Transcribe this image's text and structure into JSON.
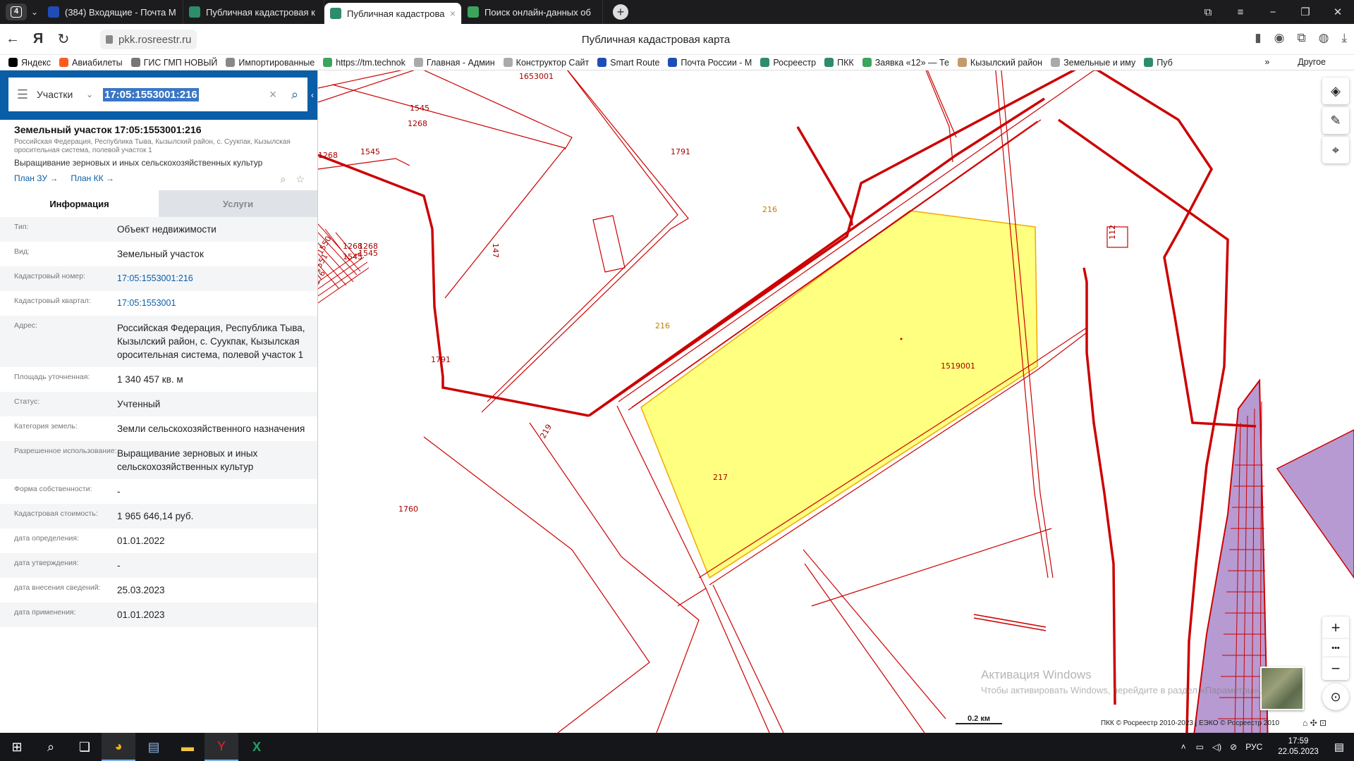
{
  "browser": {
    "tab_count": "4",
    "tabs": [
      {
        "title": "(384) Входящие - Почта M",
        "favcolor": "#1e4db7",
        "active": false
      },
      {
        "title": "Публичная кадастровая к",
        "favcolor": "#2d8c6a",
        "active": false
      },
      {
        "title": "Публичная кадастрова",
        "favcolor": "#2d8c6a",
        "active": true
      },
      {
        "title": "Поиск онлайн-данных об",
        "favcolor": "#3ba55c",
        "active": false
      }
    ],
    "url": "pkk.rosreestr.ru",
    "page_title": "Публичная кадастровая карта",
    "bookmarks": [
      {
        "label": "Яндекс",
        "color": "#000000"
      },
      {
        "label": "Авиабилеты",
        "color": "#ff5a1f"
      },
      {
        "label": "ГИС ГМП НОВЫЙ",
        "color": "#777777"
      },
      {
        "label": "Импортированные",
        "color": "#888888"
      },
      {
        "label": "https://tm.technok",
        "color": "#3ba55c"
      },
      {
        "label": "Главная - Админ",
        "color": "#aaaaaa"
      },
      {
        "label": "Конструктор Сайт",
        "color": "#aaaaaa"
      },
      {
        "label": "Smart Route",
        "color": "#1e4db7"
      },
      {
        "label": "Почта России - М",
        "color": "#1e4db7"
      },
      {
        "label": "Росреестр",
        "color": "#2d8c6a"
      },
      {
        "label": "ПКК",
        "color": "#2d8c6a"
      },
      {
        "label": "Заявка «12» — Те",
        "color": "#3ba55c"
      },
      {
        "label": "Кызылский район",
        "color": "#c59a6b"
      },
      {
        "label": "Земельные и иму",
        "color": "#aaaaaa"
      },
      {
        "label": "Пуб",
        "color": "#2d8c6a"
      }
    ],
    "bookmarks_more": "»",
    "other_label": "Другое"
  },
  "search": {
    "type_label": "Участки",
    "query": "17:05:1553001:216"
  },
  "object": {
    "title": "Земельный участок 17:05:1553001:216",
    "address_short": "Российская Федерация, Республика Тыва, Кызылский район, с. Суукпак, Кызылская оросительная система, полевой участок 1",
    "use_short": "Выращивание зерновых и иных сельскохозяйственных культур",
    "plan_zu": "План ЗУ →",
    "plan_kk": "План КК →"
  },
  "info_tabs": {
    "info": "Информация",
    "services": "Услуги"
  },
  "attributes": [
    {
      "key": "Тип:",
      "value": "Объект недвижимости",
      "link": false
    },
    {
      "key": "Вид:",
      "value": "Земельный участок",
      "link": false
    },
    {
      "key": "Кадастровый номер:",
      "value": "17:05:1553001:216",
      "link": true
    },
    {
      "key": "Кадастровый квартал:",
      "value": "17:05:1553001",
      "link": true
    },
    {
      "key": "Адрес:",
      "value": "Российская Федерация, Республика Тыва, Кызылский район, с. Суукпак, Кызылская оросительная система, полевой участок 1",
      "link": false
    },
    {
      "key": "Площадь уточненная:",
      "value": "1 340 457 кв. м",
      "link": false
    },
    {
      "key": "Статус:",
      "value": "Учтенный",
      "link": false
    },
    {
      "key": "Категория земель:",
      "value": "Земли сельскохозяйственного назначения",
      "link": false
    },
    {
      "key": "Разрешенное использование:",
      "value": "Выращивание зерновых и иных сельскохозяйственных культур",
      "link": false
    },
    {
      "key": "Форма собственности:",
      "value": "-",
      "link": false
    },
    {
      "key": "Кадастровая стоимость:",
      "value": "1 965 646,14 руб.",
      "link": false
    },
    {
      "key": "дата определения:",
      "value": "01.01.2022",
      "link": false
    },
    {
      "key": "дата утверждения:",
      "value": "-",
      "link": false
    },
    {
      "key": "дата внесения сведений:",
      "value": "25.03.2023",
      "link": false
    },
    {
      "key": "дата применения:",
      "value": "01.01.2023",
      "link": false
    }
  ],
  "map": {
    "parcel_labels": [
      "1653001",
      "1545",
      "1268",
      "1268",
      "1545",
      "1791",
      "147",
      "216",
      "216",
      "112",
      "1268",
      "1545",
      "1268",
      "1545",
      "1550",
      "1551",
      "176",
      "1791",
      "1519001",
      "219",
      "217",
      "1760"
    ],
    "colors": {
      "boundary": "#cc0000",
      "selected_fill": "#ffff80",
      "selected_stroke": "#f2a900",
      "purple_fill": "#b79ad1"
    },
    "scale_label": "0.2 км",
    "copyright": "ПКК © Росреестр 2010-2023 | ЕЭКО © Росреестр 2010",
    "watermark_title": "Активация Windows",
    "watermark_text": "Чтобы активировать Windows, перейдите в раздел «Параметры».",
    "zoom_in": "+",
    "zoom_more": "•••",
    "zoom_out": "−"
  },
  "taskbar": {
    "lang": "РУС",
    "time": "17:59",
    "date": "22.05.2023"
  }
}
